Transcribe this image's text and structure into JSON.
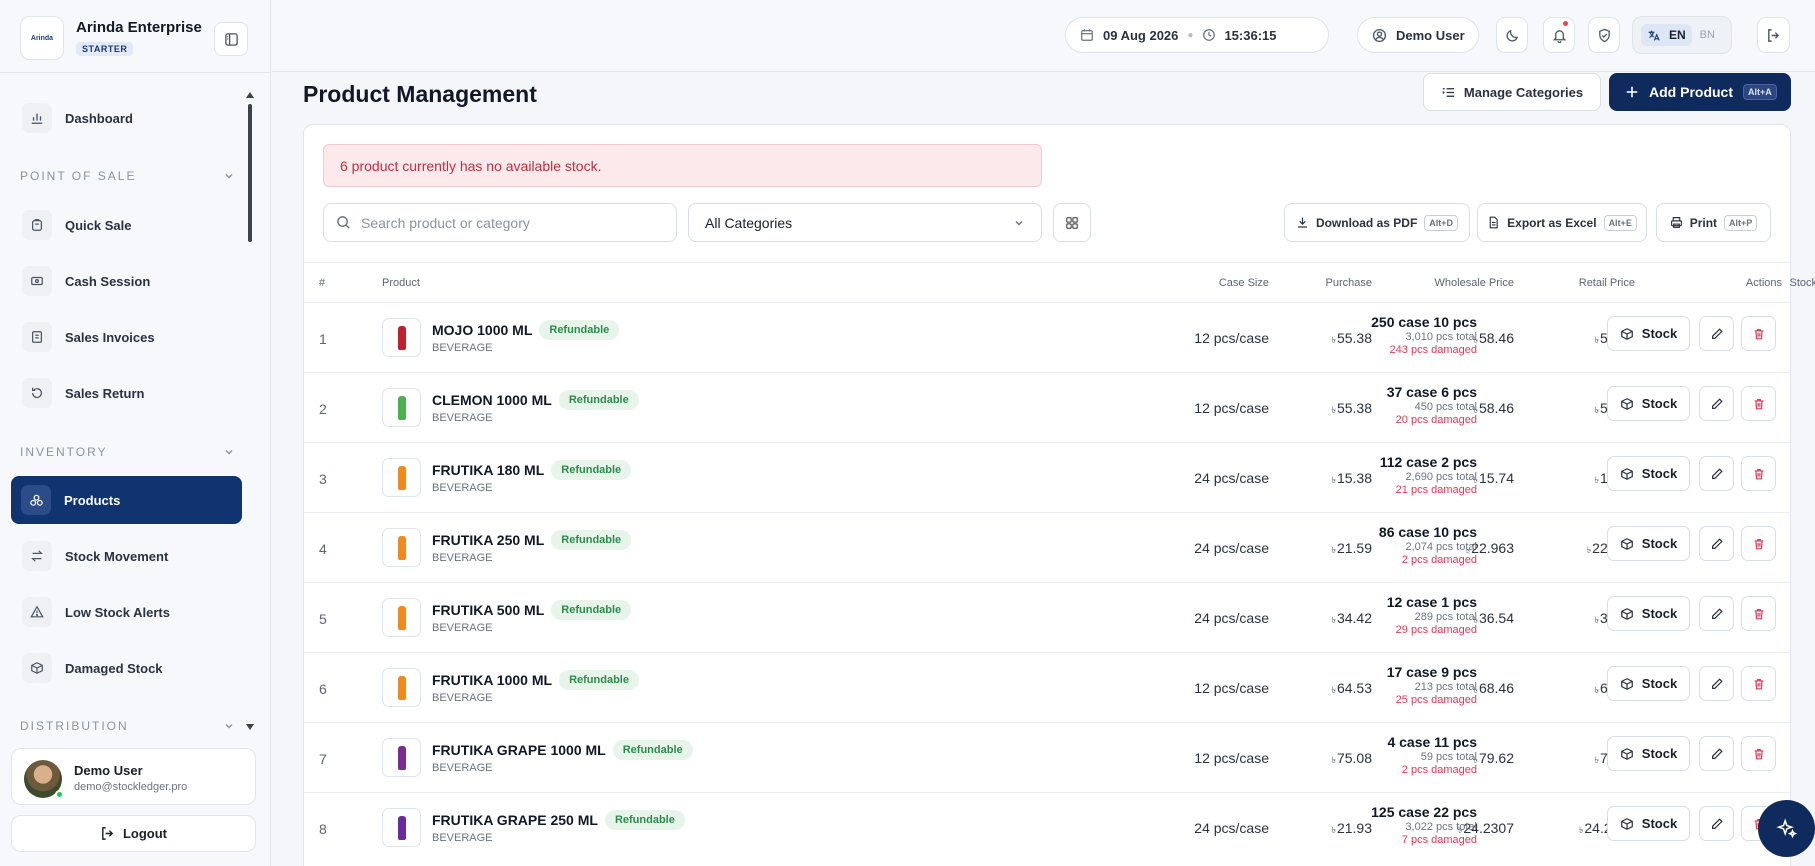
{
  "brand": {
    "name": "Arinda Enterprise",
    "plan": "STARTER",
    "logo_text": "Arinda"
  },
  "sidebar": {
    "dashboard": "Dashboard",
    "sections": {
      "pos": "POINT OF SALE",
      "inventory": "INVENTORY",
      "distribution": "DISTRIBUTION"
    },
    "pos_items": [
      "Quick Sale",
      "Cash Session",
      "Sales Invoices",
      "Sales Return"
    ],
    "inventory_items": [
      "Products",
      "Stock Movement",
      "Low Stock Alerts",
      "Damaged Stock"
    ],
    "active": "Products"
  },
  "user": {
    "name": "Demo User",
    "email": "demo@stockledger.pro",
    "logout": "Logout"
  },
  "topbar": {
    "date": "09 Aug 2026",
    "time": "15:36:15",
    "user": "Demo User",
    "lang_active": "EN",
    "lang_other": "BN"
  },
  "page": {
    "title": "Product Management",
    "manage_categories": "Manage Categories",
    "add_product": "Add Product",
    "add_shortcut": "Alt+A",
    "alert": "6 product currently has no available stock.",
    "search_placeholder": "Search product or category",
    "category_filter": "All Categories",
    "download_pdf": "Download as PDF",
    "pdf_shortcut": "Alt+D",
    "export_excel": "Export as Excel",
    "excel_shortcut": "Alt+E",
    "print": "Print",
    "print_shortcut": "Alt+P"
  },
  "table": {
    "headers": {
      "num": "#",
      "product": "Product",
      "case_size": "Case Size",
      "purchase": "Purchase",
      "wholesale": "Wholesale Price",
      "retail": "Retail Price",
      "stock": "Stock",
      "actions": "Actions"
    },
    "stock_button": "Stock",
    "currency_symbol": "৳",
    "rows": [
      {
        "num": "1",
        "name": "MOJO 1000 ML",
        "tag": "Refundable",
        "category": "BEVERAGE",
        "case_size": "12 pcs/case",
        "purchase": "55.38",
        "wholesale": "58.46",
        "retail": "58.46",
        "stock_main": "250 case 10 pcs",
        "stock_total": "3,010 pcs total",
        "stock_damaged": "243 pcs damaged",
        "color": "#c0202e"
      },
      {
        "num": "2",
        "name": "CLEMON 1000 ML",
        "tag": "Refundable",
        "category": "BEVERAGE",
        "case_size": "12 pcs/case",
        "purchase": "55.38",
        "wholesale": "58.46",
        "retail": "58.46",
        "stock_main": "37 case 6 pcs",
        "stock_total": "450 pcs total",
        "stock_damaged": "20 pcs damaged",
        "color": "#4caf50"
      },
      {
        "num": "3",
        "name": "FRUTIKA 180 ML",
        "tag": "Refundable",
        "category": "BEVERAGE",
        "case_size": "24 pcs/case",
        "purchase": "15.38",
        "wholesale": "15.74",
        "retail": "15.74",
        "stock_main": "112 case 2 pcs",
        "stock_total": "2,690 pcs total",
        "stock_damaged": "21 pcs damaged",
        "color": "#f08a1c"
      },
      {
        "num": "4",
        "name": "FRUTIKA 250 ML",
        "tag": "Refundable",
        "category": "BEVERAGE",
        "case_size": "24 pcs/case",
        "purchase": "21.59",
        "wholesale": "22.963",
        "retail": "22.963",
        "stock_main": "86 case 10 pcs",
        "stock_total": "2,074 pcs total",
        "stock_damaged": "2 pcs damaged",
        "color": "#f08a1c"
      },
      {
        "num": "5",
        "name": "FRUTIKA 500 ML",
        "tag": "Refundable",
        "category": "BEVERAGE",
        "case_size": "24 pcs/case",
        "purchase": "34.42",
        "wholesale": "36.54",
        "retail": "36.54",
        "stock_main": "12 case 1 pcs",
        "stock_total": "289 pcs total",
        "stock_damaged": "29 pcs damaged",
        "color": "#f08a1c"
      },
      {
        "num": "6",
        "name": "FRUTIKA 1000 ML",
        "tag": "Refundable",
        "category": "BEVERAGE",
        "case_size": "12 pcs/case",
        "purchase": "64.53",
        "wholesale": "68.46",
        "retail": "68.46",
        "stock_main": "17 case 9 pcs",
        "stock_total": "213 pcs total",
        "stock_damaged": "25 pcs damaged",
        "color": "#f08a1c"
      },
      {
        "num": "7",
        "name": "FRUTIKA GRAPE 1000 ML",
        "tag": "Refundable",
        "category": "BEVERAGE",
        "case_size": "12 pcs/case",
        "purchase": "75.08",
        "wholesale": "79.62",
        "retail": "79.62",
        "stock_main": "4 case 11 pcs",
        "stock_total": "59 pcs total",
        "stock_damaged": "2 pcs damaged",
        "color": "#7b2c8f"
      },
      {
        "num": "8",
        "name": "FRUTIKA GRAPE 250 ML",
        "tag": "Refundable",
        "category": "BEVERAGE",
        "case_size": "24 pcs/case",
        "purchase": "21.93",
        "wholesale": "24.2307",
        "retail": "24.2307",
        "stock_main": "125 case 22 pcs",
        "stock_total": "3,022 pcs total",
        "stock_damaged": "7 pcs damaged",
        "color": "#6a2c9a"
      }
    ]
  }
}
